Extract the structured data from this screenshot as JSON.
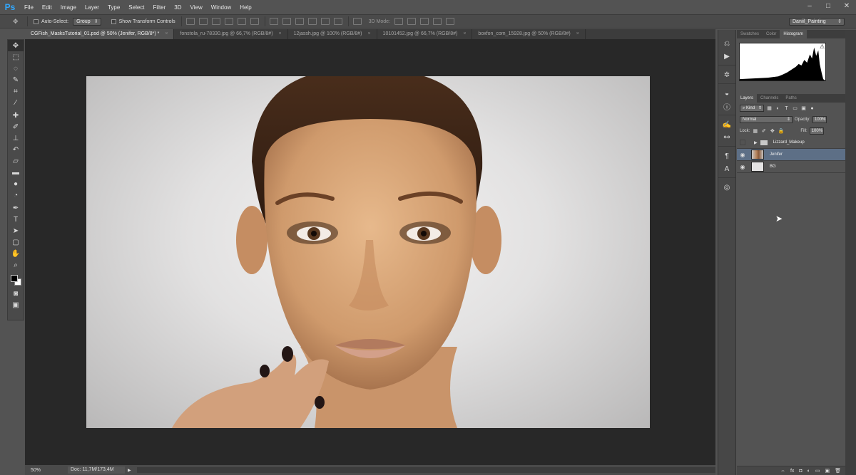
{
  "app": {
    "logo": "Ps"
  },
  "menu": [
    "File",
    "Edit",
    "Image",
    "Layer",
    "Type",
    "Select",
    "Filter",
    "3D",
    "View",
    "Window",
    "Help"
  ],
  "window_controls": {
    "minimize": "–",
    "maximize": "□",
    "close": "✕"
  },
  "options_bar": {
    "auto_select_label": "Auto-Select:",
    "auto_select_value": "Group",
    "show_transform_label": "Show Transform Controls",
    "mode_3d_label": "3D Mode:",
    "workspace": "Daniil_Painting"
  },
  "tabs": [
    {
      "title": "CGFish_MasksTutorial_01.psd @ 50% (Jenifer, RGB/8*) *",
      "active": true
    },
    {
      "title": "fonstola_ru-78330.jpg @ 66,7% (RGB/8#)",
      "active": false
    },
    {
      "title": "12jassh.jpg @ 100% (RGB/8#)",
      "active": false
    },
    {
      "title": "10101452.jpg @ 66,7% (RGB/8#)",
      "active": false
    },
    {
      "title": "boxfon_com_15928.jpg @ 50% (RGB/8#)",
      "active": false
    }
  ],
  "tab_close": "×",
  "status": {
    "zoom": "50%",
    "doc": "Doc: 11,7M/173,4M",
    "arrow": "▶"
  },
  "panels": {
    "top_tabs": [
      "Swatches",
      "Color",
      "Histogram"
    ],
    "histogram_warning": "⚠",
    "layer_tabs": [
      "Layers",
      "Channels",
      "Paths"
    ],
    "kind": "Kind",
    "blend_mode": "Normal",
    "opacity_label": "Opacity:",
    "opacity_value": "100%",
    "lock_label": "Lock:",
    "fill_label": "Fill:",
    "fill_value": "100%",
    "layers": [
      {
        "name": "Lizzard_Makeup",
        "type": "group",
        "visible": false
      },
      {
        "name": "Jenifer",
        "type": "image",
        "visible": true,
        "selected": true
      },
      {
        "name": "BG",
        "type": "fill",
        "visible": true
      }
    ],
    "footer_icons": [
      "⇔",
      "fx",
      "◘",
      "◐",
      "▭",
      "▣",
      "🗑"
    ]
  },
  "colors": {
    "accent": "#31a8ff",
    "selected_layer": "#5d6f86",
    "foreground": "#000000",
    "background": "#ffffff"
  }
}
